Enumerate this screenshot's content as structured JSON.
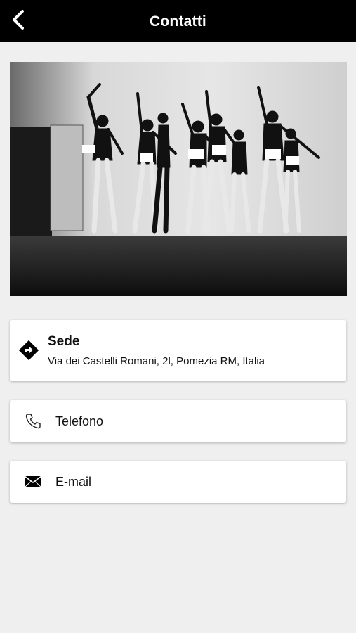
{
  "header": {
    "title": "Contatti",
    "back_icon": "chevron-left-icon"
  },
  "hero": {
    "description_icon": "photo"
  },
  "location": {
    "title": "Sede",
    "address": "Via dei Castelli Romani, 2l, Pomezia RM, Italia",
    "icon": "directions-icon"
  },
  "phone": {
    "label": "Telefono",
    "icon": "phone-icon"
  },
  "email": {
    "label": "E-mail",
    "icon": "envelope-icon"
  },
  "colors": {
    "header_bg": "#000000",
    "page_bg": "#efefef",
    "card_bg": "#ffffff"
  }
}
